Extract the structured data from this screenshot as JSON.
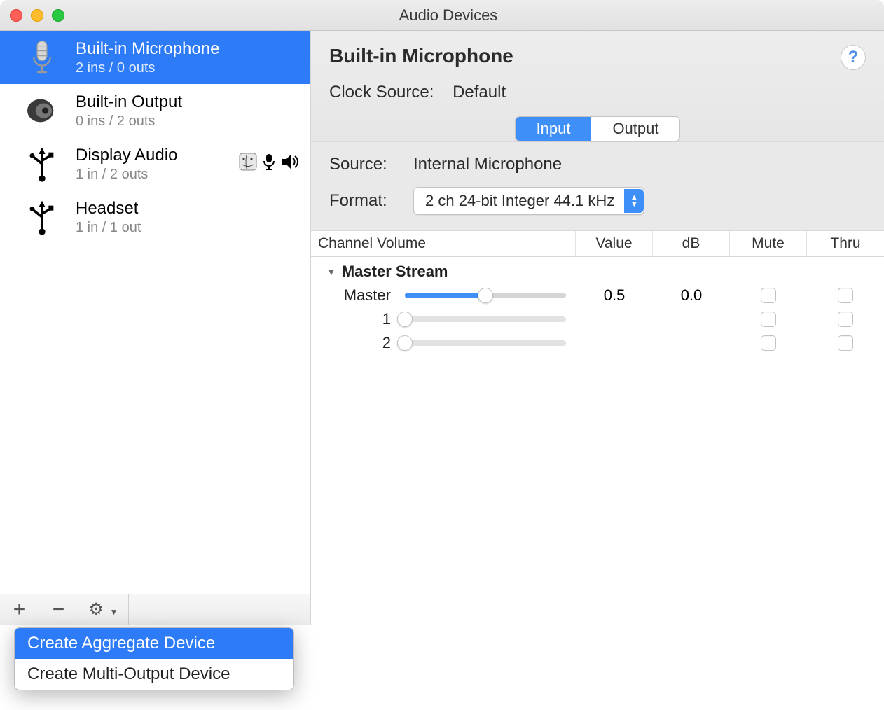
{
  "window": {
    "title": "Audio Devices"
  },
  "sidebar": {
    "devices": [
      {
        "name": "Built-in Microphone",
        "detail": "2 ins / 0 outs",
        "icon": "microphone-icon",
        "selected": true
      },
      {
        "name": "Built-in Output",
        "detail": "0 ins / 2 outs",
        "icon": "speaker-icon",
        "selected": false
      },
      {
        "name": "Display Audio",
        "detail": "1 in / 2 outs",
        "icon": "usb-icon",
        "selected": false,
        "status": [
          "finder",
          "mic",
          "speaker"
        ]
      },
      {
        "name": "Headset",
        "detail": "1 in / 1 out",
        "icon": "usb-icon",
        "selected": false
      }
    ],
    "toolbar": {
      "add": "+",
      "remove": "−",
      "gear": "⚙"
    }
  },
  "detail": {
    "title": "Built-in Microphone",
    "clock_label": "Clock Source:",
    "clock_value": "Default",
    "tabs": {
      "input": "Input",
      "output": "Output",
      "active": "input"
    },
    "source_label": "Source:",
    "source_value": "Internal Microphone",
    "format_label": "Format:",
    "format_value": "2 ch 24-bit Integer 44.1 kHz"
  },
  "table": {
    "headers": {
      "channel": "Channel Volume",
      "value": "Value",
      "db": "dB",
      "mute": "Mute",
      "thru": "Thru"
    },
    "stream_label": "Master Stream",
    "rows": [
      {
        "label": "Master",
        "slider": 0.5,
        "value": "0.5",
        "db": "0.0",
        "enabled": true
      },
      {
        "label": "1",
        "slider": 0,
        "value": "",
        "db": "",
        "enabled": false
      },
      {
        "label": "2",
        "slider": 0,
        "value": "",
        "db": "",
        "enabled": false
      }
    ]
  },
  "popup": {
    "items": [
      {
        "label": "Create Aggregate Device",
        "active": true
      },
      {
        "label": "Create Multi-Output Device",
        "active": false
      }
    ]
  }
}
